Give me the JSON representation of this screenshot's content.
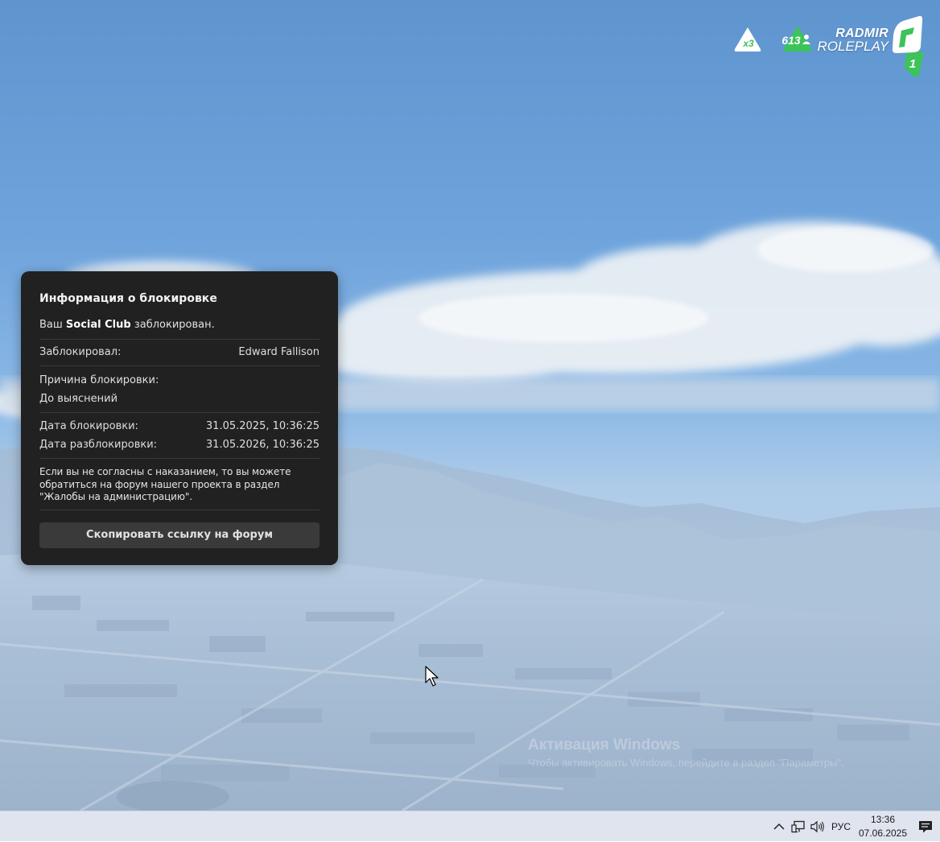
{
  "hud": {
    "multiplier": "x3",
    "online_count": "613",
    "brand_line1": "RADMIR",
    "brand_line2": "ROLEPLAY",
    "server_number": "1",
    "accent": "#3cc35a"
  },
  "dialog": {
    "title": "Информация о блокировке",
    "status_prefix": "Ваш ",
    "status_bold": "Social Club",
    "status_suffix": " заблокирован.",
    "banned_by_label": "Заблокировал:",
    "banned_by_value": "Edward Fallison",
    "reason_label": "Причина блокировки:",
    "reason_value": "До выяснений",
    "ban_date_label": "Дата блокировки:",
    "ban_date_value": "31.05.2025, 10:36:25",
    "unban_date_label": "Дата разблокировки:",
    "unban_date_value": "31.05.2026, 10:36:25",
    "notice_line1": "Если вы не согласны с наказанием, то вы можете",
    "notice_line2": "обратиться на форум нашего проекта в раздел",
    "notice_line3": "\"Жалобы на администрацию\".",
    "copy_button_label": "Скопировать ссылку на форум"
  },
  "watermark": {
    "title": "Активация Windows",
    "subtitle": "Чтобы активировать Windows, перейдите в раздел \"Параметры\"."
  },
  "taskbar": {
    "language": "РУС",
    "time": "13:36",
    "date": "07.06.2025"
  },
  "icons": {
    "tray_chevron": "chevron-up-icon",
    "network": "network-icon",
    "volume": "volume-icon",
    "notifications": "notification-icon",
    "cursor": "mouse-cursor-icon"
  }
}
